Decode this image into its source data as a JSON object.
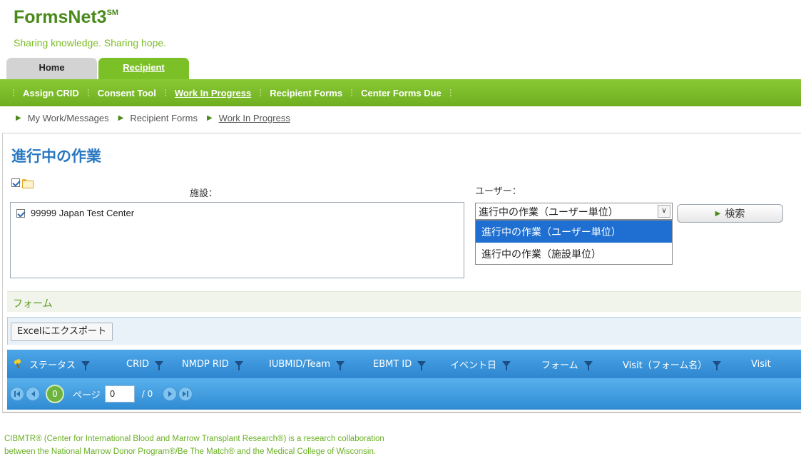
{
  "brand": {
    "title": "FormsNet3",
    "mark": "SM",
    "tagline": "Sharing knowledge. Sharing hope."
  },
  "tabs": {
    "home": "Home",
    "recipient": "Recipient"
  },
  "nav": {
    "items": [
      "Assign CRID",
      "Consent Tool",
      "Work In Progress",
      "Recipient Forms",
      "Center Forms Due"
    ],
    "active": "Work In Progress",
    "separator": "⋮"
  },
  "breadcrumb": [
    "My Work/Messages",
    "Recipient Forms",
    "Work In Progress"
  ],
  "page": {
    "title": "進行中の作業",
    "facility_label": "施設：",
    "user_label": "ユーザー：",
    "facility_item": "99999 Japan Test Center",
    "user_select_value": "進行中の作業（ユーザー単位）",
    "dropdown_options": [
      "進行中の作業（ユーザー単位）",
      "進行中の作業（施設単位）"
    ],
    "search_button": "検索"
  },
  "forms": {
    "title": "フォーム",
    "export_button": "Excelにエクスポート",
    "columns": [
      "ステータス",
      "CRID",
      "NMDP RID",
      "IUBMID/Team",
      "EBMT ID",
      "イベント日",
      "フォーム",
      "Visit（フォーム名）",
      "Visit"
    ],
    "pager": {
      "current": "0",
      "page_label": "ページ",
      "page_value": "0",
      "total": "/ 0"
    }
  },
  "footer": {
    "line1": "CIBMTR® (Center for International Blood and Marrow Transplant Research®) is a research collaboration",
    "line2": "between the National Marrow Donor Program®/Be The Match® and the Medical College of Wisconsin."
  },
  "colors": {
    "brand_green": "#4a8a1b",
    "nav_green": "#7cc028",
    "title_blue": "#2a78c2",
    "grid_blue": "#2d86cf",
    "select_blue": "#1e6fd1"
  }
}
